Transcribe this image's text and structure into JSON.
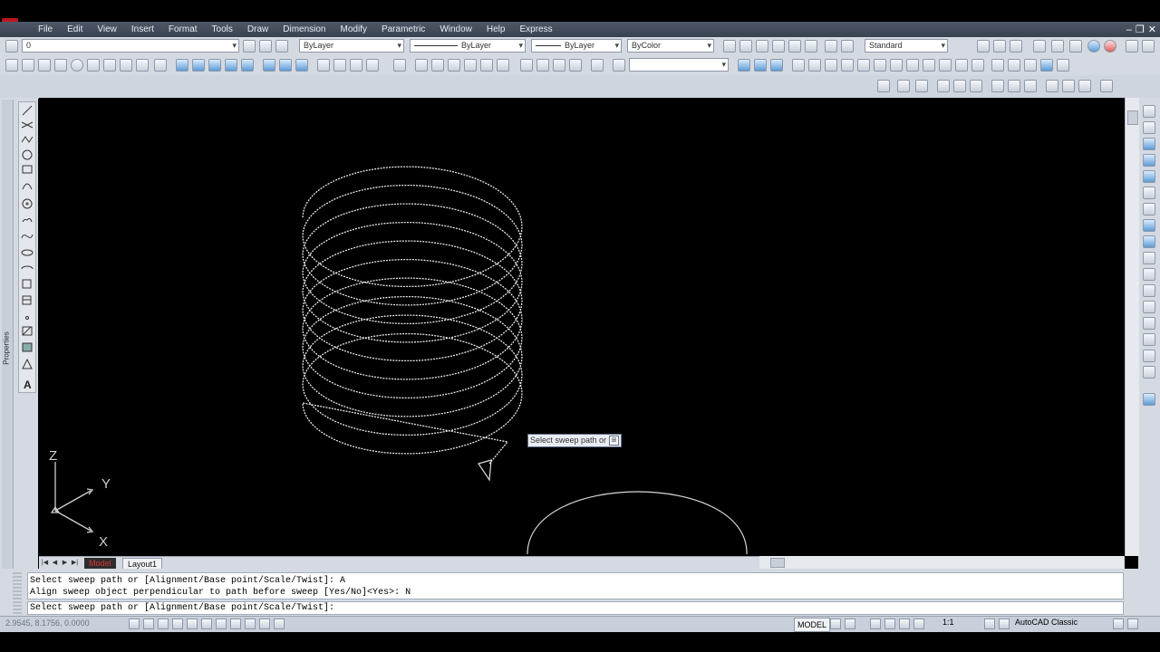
{
  "menu": [
    "File",
    "Edit",
    "View",
    "Insert",
    "Format",
    "Tools",
    "Draw",
    "Dimension",
    "Modify",
    "Parametric",
    "Window",
    "Help",
    "Express"
  ],
  "toolbar": {
    "layer_value": "0",
    "color": "ByLayer",
    "linetype": "ByLayer",
    "lineweight": "ByLayer",
    "plotstyle": "ByColor",
    "dimstyle": "Standard"
  },
  "left_panel": {
    "properties_label": "Properties"
  },
  "ucs": {
    "x_label": "X",
    "y_label": "Y",
    "z_label": "Z"
  },
  "dynamic_input": {
    "prompt": "Select sweep path or",
    "arrow": "⊞"
  },
  "layout_tabs": [
    {
      "label": "Model"
    },
    {
      "label": "Layout1"
    }
  ],
  "nav_arrows": [
    "|◀",
    "◀",
    "▶",
    "▶|"
  ],
  "command": {
    "history": [
      "Select sweep path or [Alignment/Base point/Scale/Twist]: A",
      "Align sweep object perpendicular to path before sweep [Yes/No]<Yes>: N"
    ],
    "current": "Select sweep path or [Alignment/Base point/Scale/Twist]:"
  },
  "status": {
    "coords": "2.9545, 8.1756, 0.0000",
    "model": "MODEL",
    "annotation_scale": "1:1",
    "workspace": "AutoCAD Classic"
  },
  "colors": {
    "menubar": "#3f4857",
    "toolbar": "#d5dae2",
    "viewport": "#000000",
    "helix": "#e8e8e8",
    "model_tab_text": "#dd3333"
  }
}
